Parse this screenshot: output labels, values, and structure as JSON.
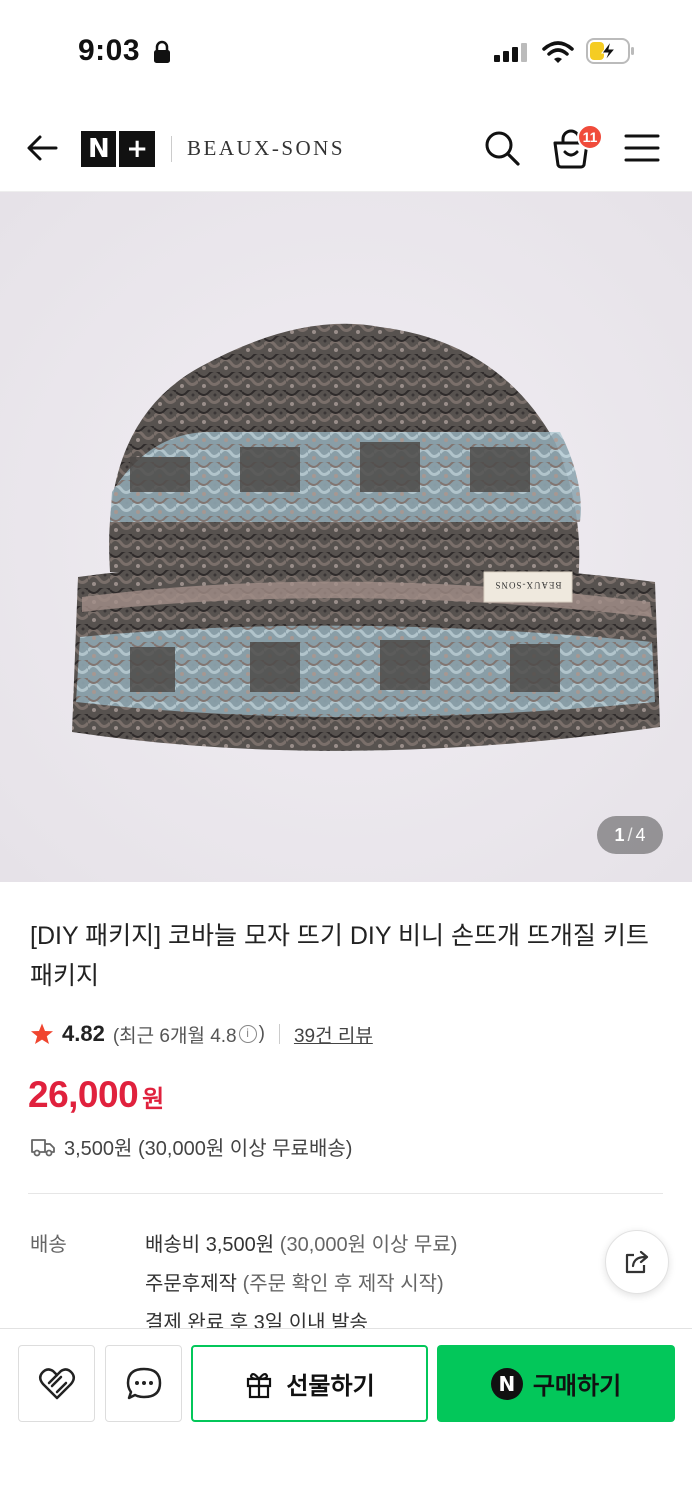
{
  "status_bar": {
    "time": "9:03",
    "icons": [
      "lock-icon",
      "signal-icon",
      "wifi-icon",
      "battery-charging-icon"
    ]
  },
  "header": {
    "logo_text": "N+",
    "brand": "BEAUX-SONS",
    "cart_count": "11",
    "icons": [
      "back-arrow-icon",
      "search-icon",
      "cart-icon",
      "menu-icon"
    ]
  },
  "gallery": {
    "current": "1",
    "total": "4",
    "label_on_product": "BEAUX-SONS"
  },
  "product": {
    "title": "[DIY 패키지] 코바늘 모자 뜨기 DIY 비니 손뜨개 뜨개질 키트 패키지",
    "rating": "4.82",
    "recent_rating": "(최근 6개월 4.8",
    "recent_rating_close": ")",
    "info_glyph": "i",
    "review_link": "39건 리뷰",
    "price": "26,000",
    "price_unit": "원",
    "shipping_fee": "3,500원 (30,000원 이상 무료배송)",
    "price_color": "#e0213d"
  },
  "delivery": {
    "label": "배송",
    "line1_main": "배송비 3,500원",
    "line1_note": "(30,000원 이상 무료)",
    "line2_main": "주문후제작",
    "line2_note": "(주문 확인 후 제작 시작)",
    "line3_main": "결제 완료 후 3일 이내 발송"
  },
  "bottom_bar": {
    "gift_label": "선물하기",
    "buy_label": "구매하기",
    "buy_logo": "N",
    "accent_color": "#03c75a"
  }
}
